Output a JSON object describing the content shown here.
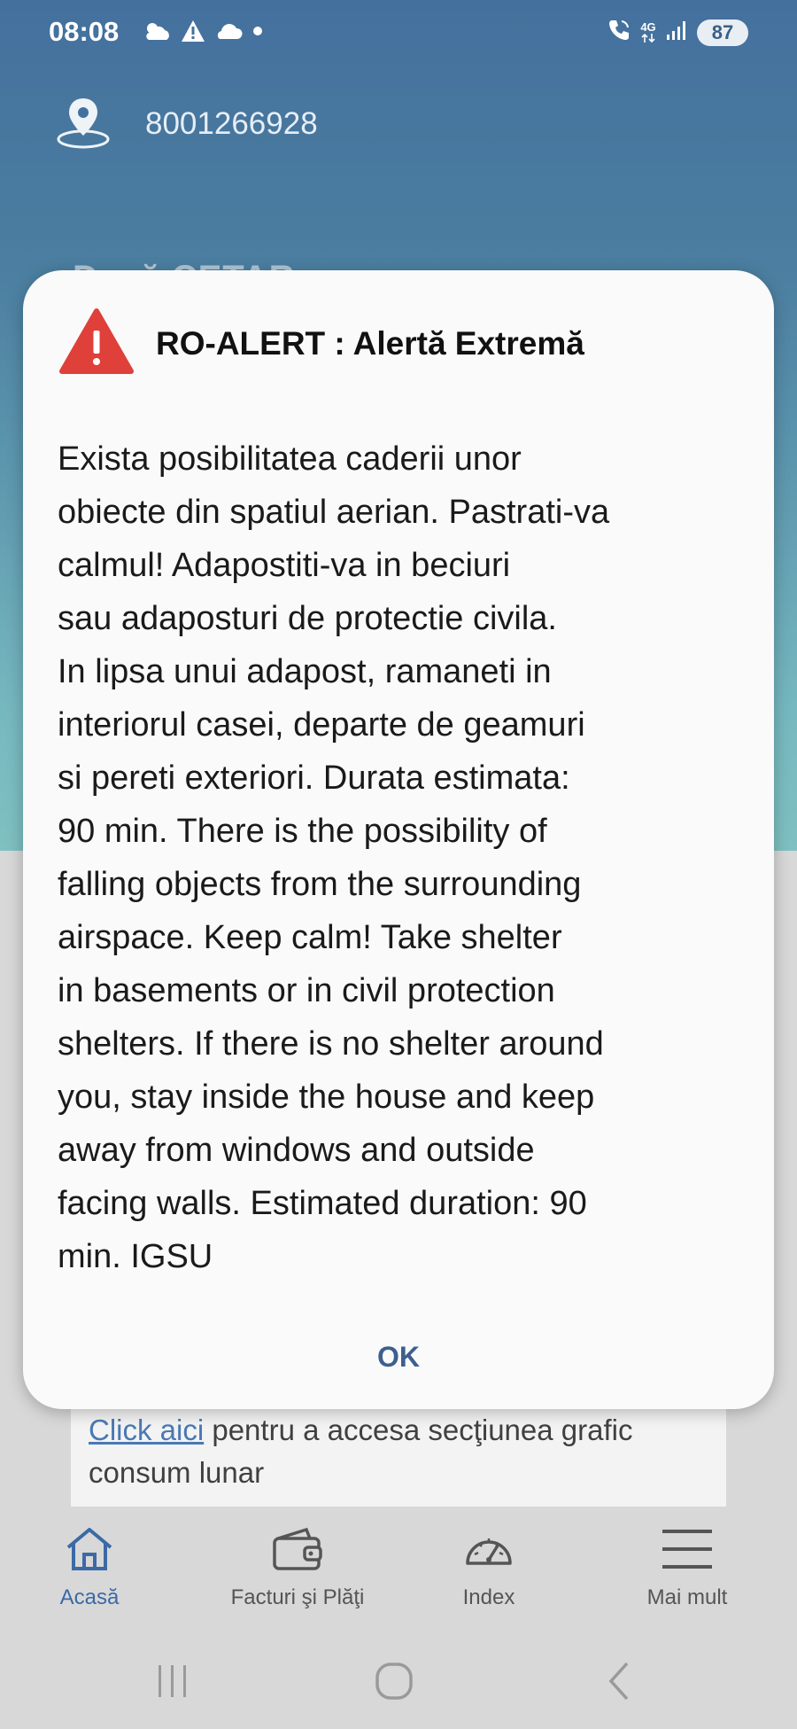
{
  "status_bar": {
    "time": "08:08",
    "network_label": "4G",
    "battery_level": "87",
    "icons": [
      "weather-icon",
      "warning-icon",
      "cloud-icon",
      "dot-icon",
      "call-wifi-icon",
      "network-arrows-icon",
      "signal-icon"
    ]
  },
  "header": {
    "account_number": "8001266928",
    "background_heading": "Dacă CETAR"
  },
  "dialog": {
    "title": "RO-ALERT : Alertă Extremă",
    "message": "Exista posibilitatea caderii unor\nobiecte din spatiul aerian. Pastrati-va\ncalmul! Adapostiti-va in beciuri\nsau adaposturi de protectie civila.\nIn lipsa unui adapost, ramaneti in\ninteriorul casei, departe de geamuri\nsi pereti exteriori. Durata estimata:\n90 min. There is the possibility of\nfalling objects from the surrounding\nairspace. Keep calm! Take shelter\nin basements or in civil protection\nshelters. If there is no shelter around\nyou, stay inside the house and keep\naway from windows and outside\nfacing walls. Estimated duration: 90\nmin. IGSU",
    "ok_label": "OK",
    "alert_color": "#e0403a"
  },
  "info_card": {
    "link_text": "Click aici",
    "text": " pentru a accesa secţiunea grafic consum lunar"
  },
  "bottom_nav": {
    "items": [
      {
        "label": "Acasă",
        "icon": "home-icon",
        "active": true
      },
      {
        "label": "Facturi şi Plăţi",
        "icon": "wallet-icon",
        "active": false
      },
      {
        "label": "Index",
        "icon": "gauge-icon",
        "active": false
      },
      {
        "label": "Mai mult",
        "icon": "menu-icon",
        "active": false
      }
    ]
  },
  "colors": {
    "header_blue": "#44709d",
    "accent": "#3b6aa6",
    "ok_button": "#3d5f8f"
  }
}
